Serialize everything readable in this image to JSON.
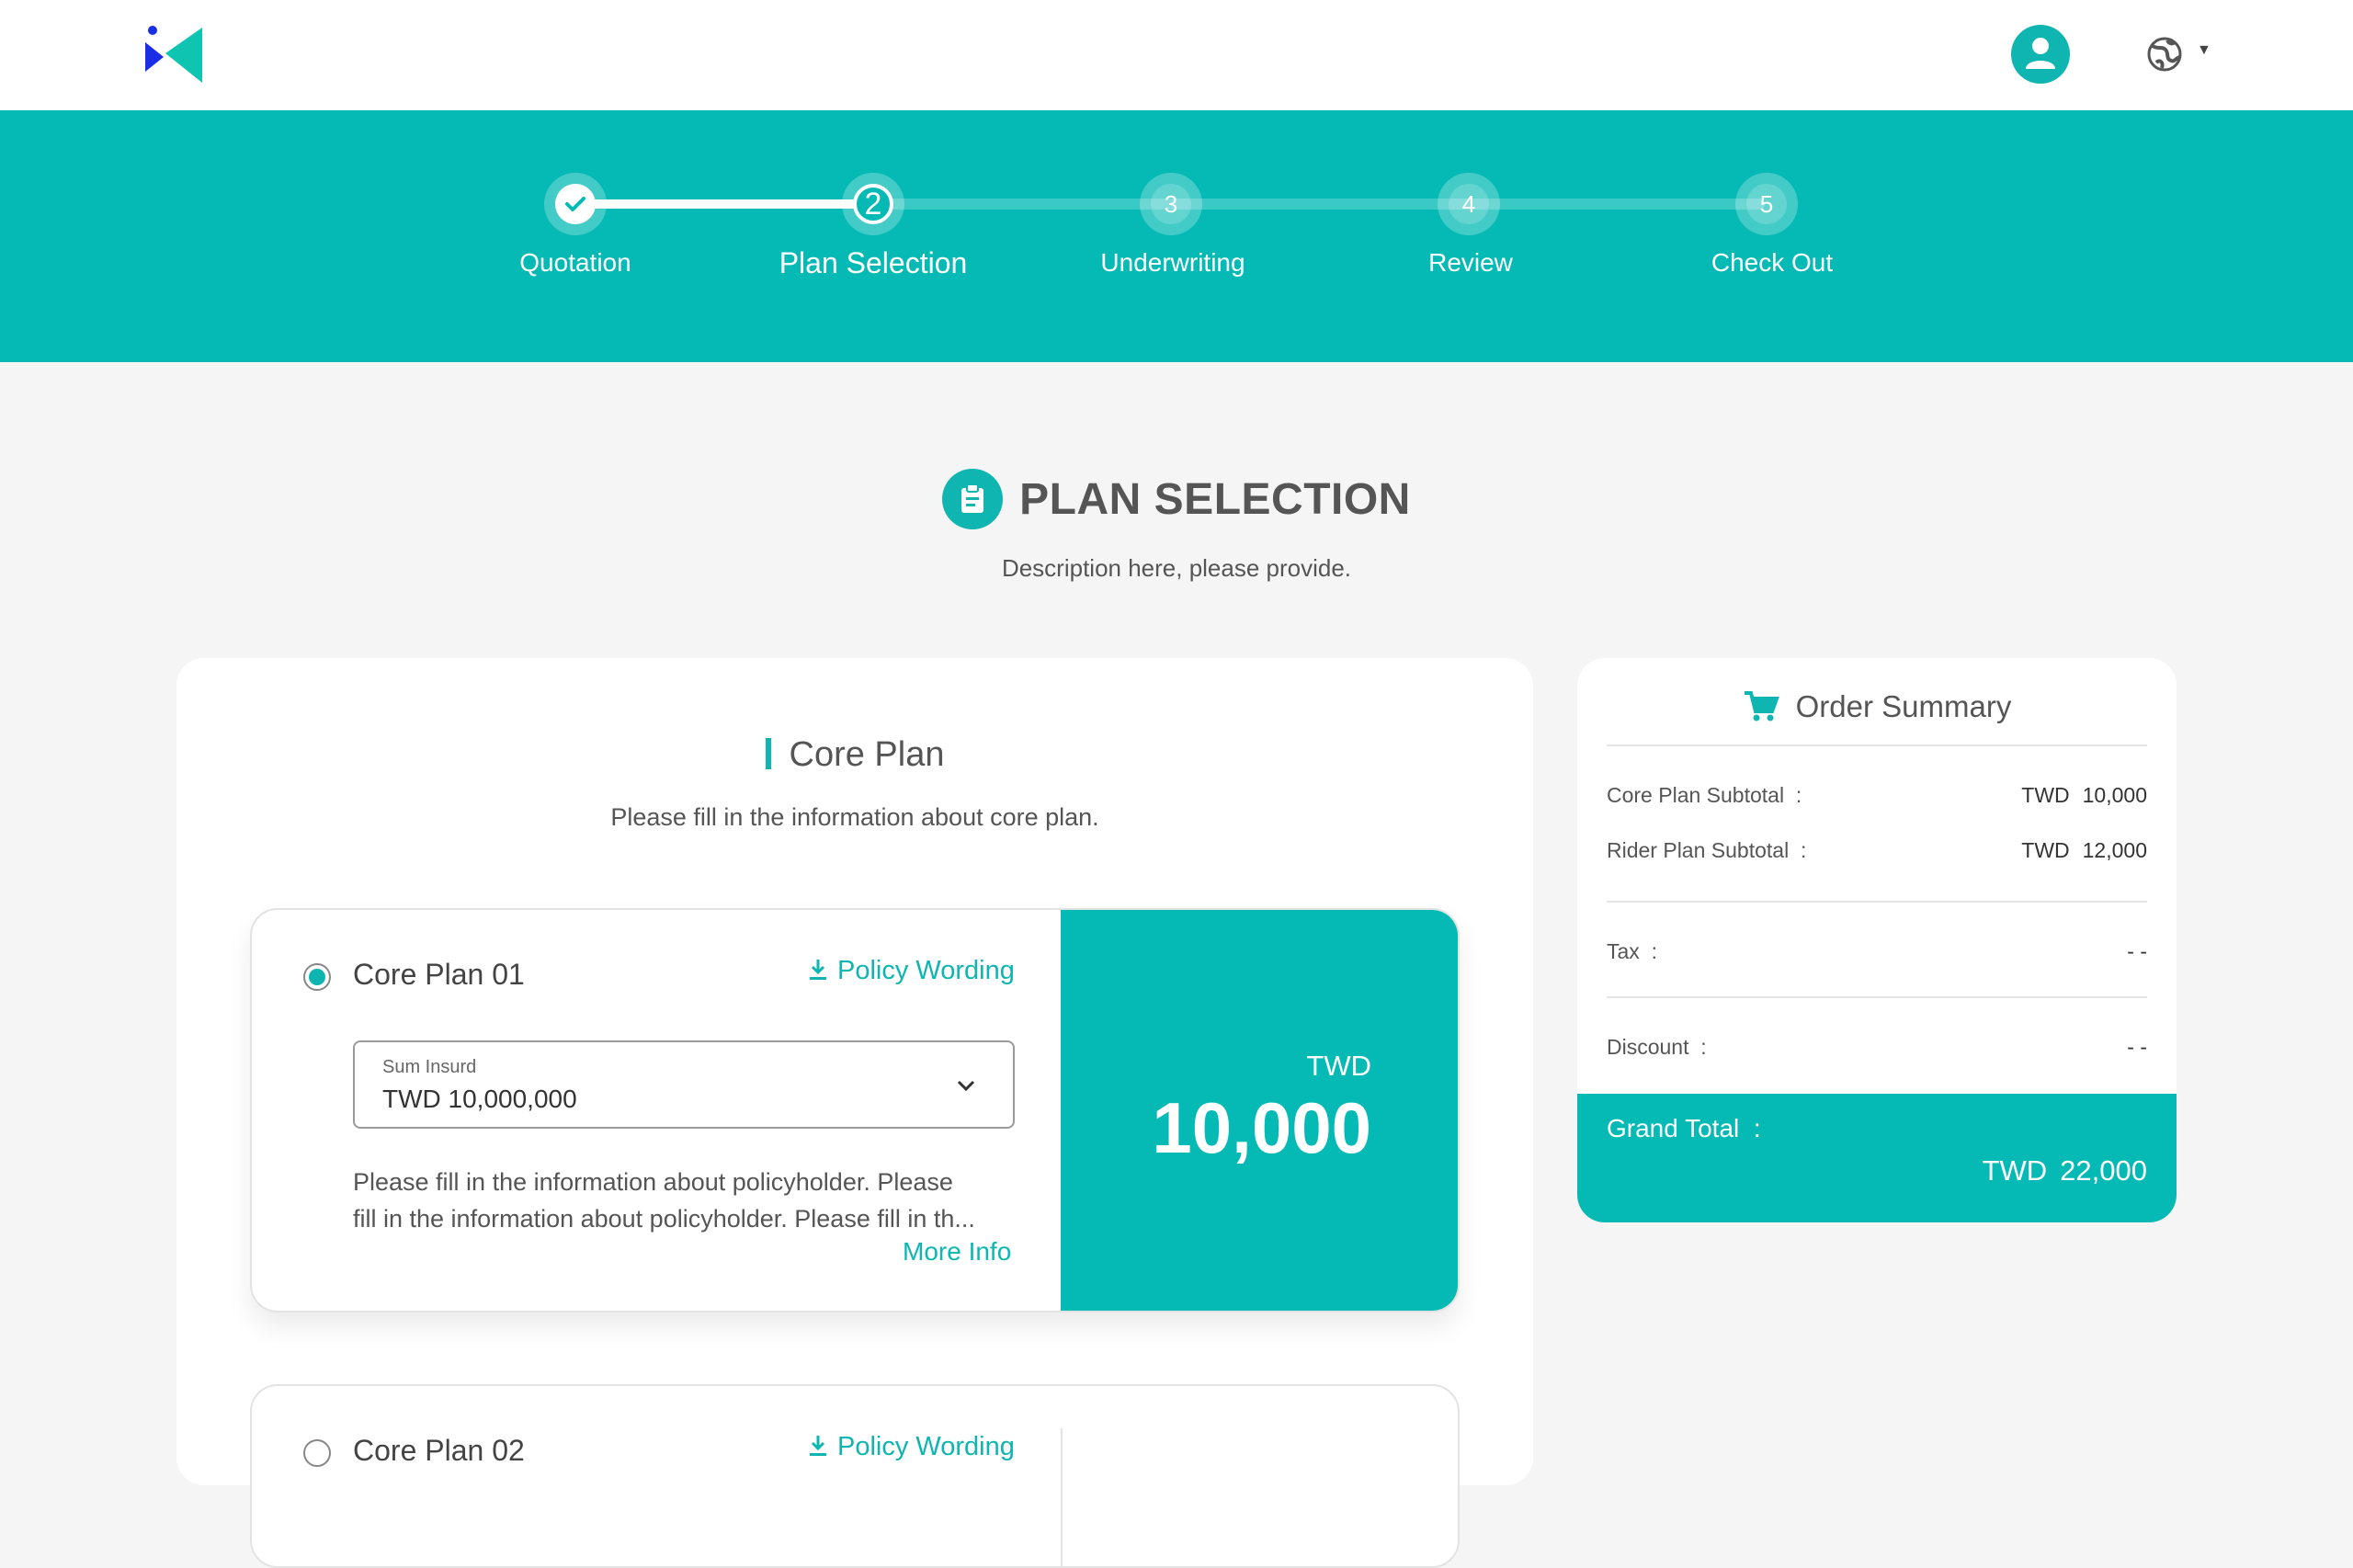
{
  "header": {
    "logo": "app-logo",
    "avatar_icon": "user-icon",
    "language_icon": "globe-icon"
  },
  "stepper": {
    "steps": [
      {
        "number": "1",
        "label": "Quotation",
        "state": "done"
      },
      {
        "number": "2",
        "label": "Plan Selection",
        "state": "current"
      },
      {
        "number": "3",
        "label": "Underwriting",
        "state": "upcoming"
      },
      {
        "number": "4",
        "label": "Review",
        "state": "upcoming"
      },
      {
        "number": "5",
        "label": "Check Out",
        "state": "upcoming"
      }
    ]
  },
  "page": {
    "title": "PLAN SELECTION",
    "description": "Description here, please provide."
  },
  "core_plan": {
    "title": "Core Plan",
    "description": "Please fill in the information about core plan.",
    "plans": [
      {
        "name": "Core Plan 01",
        "selected": true,
        "policy_link": "Policy Wording",
        "sum_insured_label": "Sum Insurd",
        "sum_insured_value": "TWD 10,000,000",
        "desc_line1": "Please fill in the information about policyholder. Please",
        "desc_line2": "fill in the information about policyholder. Please fill in th...",
        "more_info": "More Info",
        "price_currency": "TWD",
        "price_value": "10,000"
      },
      {
        "name": "Core Plan 02",
        "selected": false,
        "policy_link": "Policy Wording"
      }
    ]
  },
  "order_summary": {
    "title": "Order Summary",
    "rows": [
      {
        "label": "Core Plan Subtotal",
        "sep": ":",
        "currency": "TWD",
        "value": "10,000"
      },
      {
        "label": "Rider Plan Subtotal",
        "sep": ":",
        "currency": "TWD",
        "value": "12,000"
      },
      {
        "label": "Tax",
        "sep": ":",
        "currency": "",
        "value": "- -"
      },
      {
        "label": "Discount",
        "sep": ":",
        "currency": "",
        "value": "- -"
      }
    ],
    "grand_total_label": "Grand Total",
    "grand_total_sep": ":",
    "grand_total_currency": "TWD",
    "grand_total_value": "22,000"
  },
  "colors": {
    "accent": "#05bab5",
    "logo_blue": "#1a2ee6",
    "logo_teal": "#10c4b2"
  }
}
